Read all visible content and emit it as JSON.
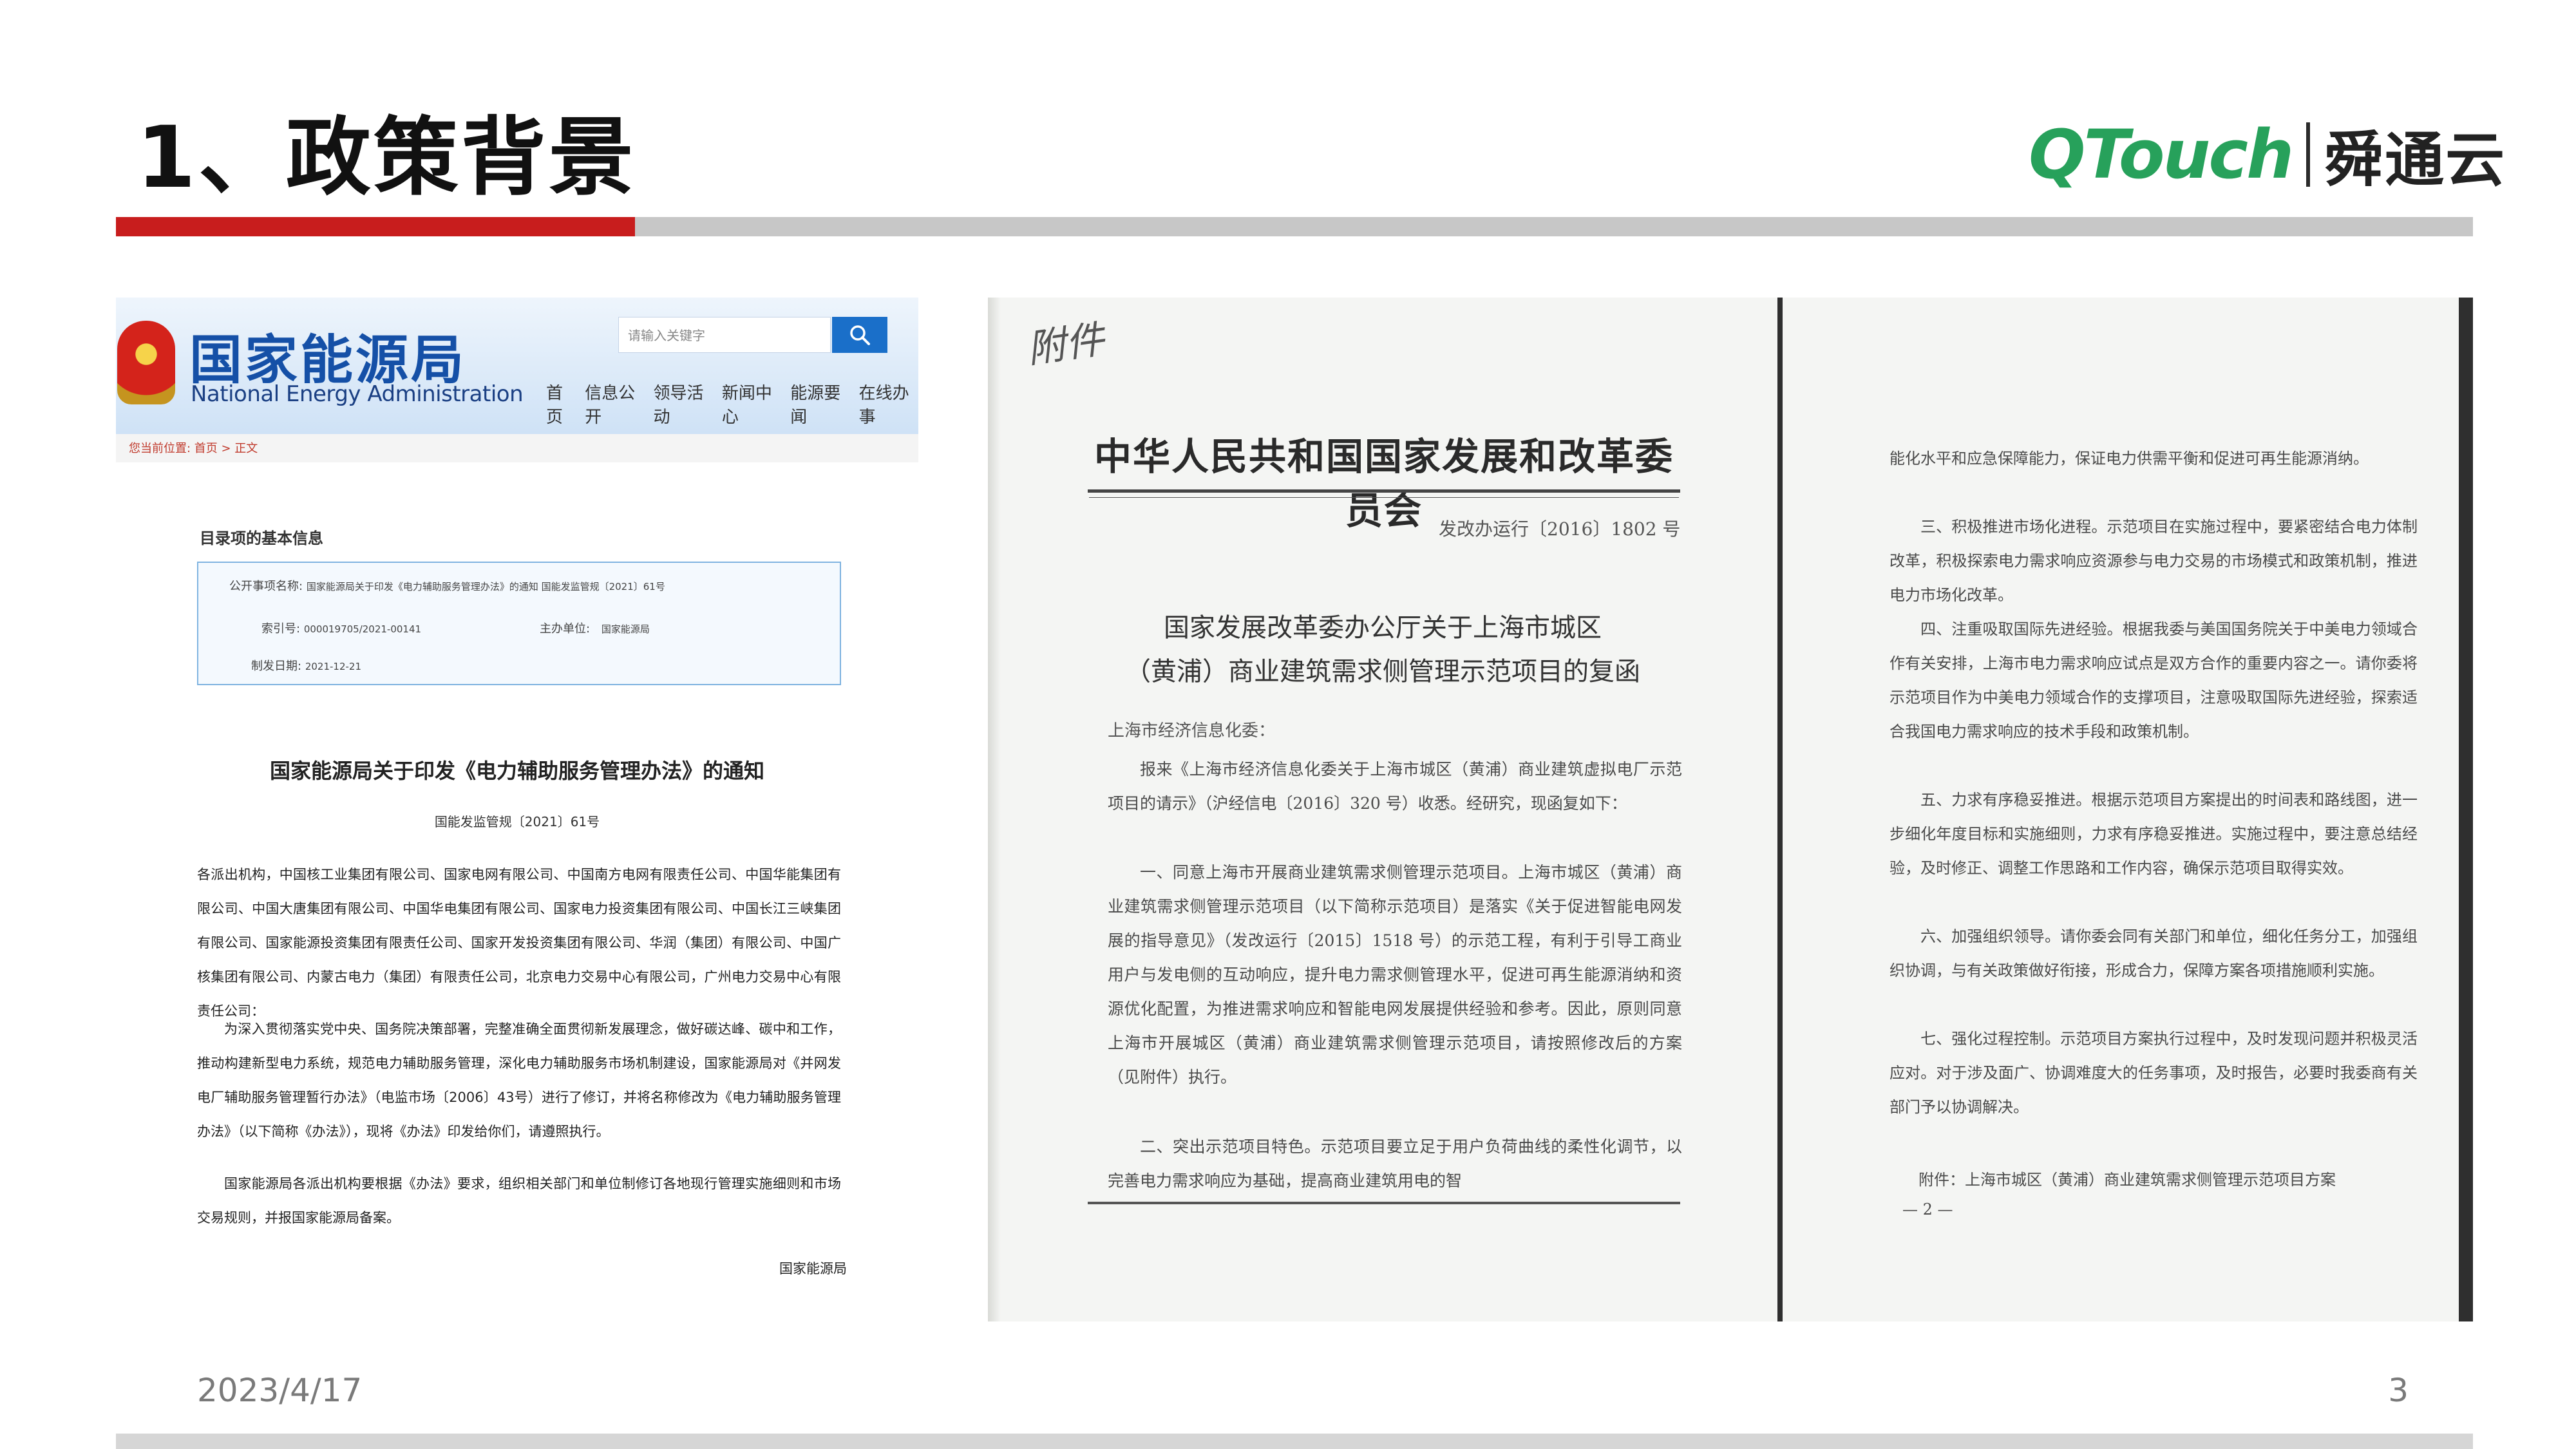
{
  "slide": {
    "title": "1、政策背景",
    "logo_brand": "QTouch",
    "logo_cn": "舜通云",
    "date": "2023/4/17",
    "page_number": "3",
    "accent_color": "#c81d1d"
  },
  "nea_page": {
    "site_name_cn": "国家能源局",
    "site_name_en": "National Energy Administration",
    "search_placeholder": "请输入关键字",
    "nav": [
      "首页",
      "信息公开",
      "领导活动",
      "新闻中心",
      "能源要闻",
      "在线办事"
    ],
    "breadcrumb": "您当前位置: 首页 > 正文",
    "info_heading": "目录项的基本信息",
    "info": {
      "name_label": "公开事项名称:",
      "name_value": "国家能源局关于印发《电力辅助服务管理办法》的通知 国能发监管规〔2021〕61号",
      "index_label": "索引号:",
      "index_value": "000019705/2021-00141",
      "dept_label": "主办单位:",
      "dept_value": "国家能源局",
      "date_label": "制发日期:",
      "date_value": "2021-12-21"
    },
    "notice_title": "国家能源局关于印发《电力辅助服务管理办法》的通知",
    "notice_no": "国能发监管规〔2021〕61号",
    "para1": "各派出机构，中国核工业集团有限公司、国家电网有限公司、中国南方电网有限责任公司、中国华能集团有限公司、中国大唐集团有限公司、中国华电集团有限公司、国家电力投资集团有限公司、中国长江三峡集团有限公司、国家能源投资集团有限责任公司、国家开发投资集团有限公司、华润（集团）有限公司、中国广核集团有限公司、内蒙古电力（集团）有限责任公司，北京电力交易中心有限公司，广州电力交易中心有限责任公司：",
    "para2": "为深入贯彻落实党中央、国务院决策部署，完整准确全面贯彻新发展理念，做好碳达峰、碳中和工作，推动构建新型电力系统，规范电力辅助服务管理，深化电力辅助服务市场机制建设，国家能源局对《并网发电厂辅助服务管理暂行办法》（电监市场〔2006〕43号）进行了修订，并将名称修改为《电力辅助服务管理办法》（以下简称《办法》），现将《办法》印发给你们，请遵照执行。",
    "para3": "国家能源局各派出机构要根据《办法》要求，组织相关部门和单位制修订各地现行管理实施细则和市场交易规则，并报国家能源局备案。",
    "signature": "国家能源局"
  },
  "ndrc_doc": {
    "annotation": "附件",
    "org": "中华人民共和国国家发展和改革委员会",
    "doc_no": "发改办运行〔2016〕1802 号",
    "title_line1": "国家发展改革委办公厅关于上海市城区",
    "title_line2": "（黄浦）商业建筑需求侧管理示范项目的复函",
    "salutation": "上海市经济信息化委：",
    "p1": "报来《上海市经济信息化委关于上海市城区（黄浦）商业建筑虚拟电厂示范项目的请示》（沪经信电〔2016〕320 号）收悉。经研究，现函复如下：",
    "p2": "一、同意上海市开展商业建筑需求侧管理示范项目。上海市城区（黄浦）商业建筑需求侧管理示范项目（以下简称示范项目）是落实《关于促进智能电网发展的指导意见》（发改运行〔2015〕1518 号）的示范工程，有利于引导工商业用户与发电侧的互动响应，提升电力需求侧管理水平，促进可再生能源消纳和资源优化配置，为推进需求响应和智能电网发展提供经验和参考。因此，原则同意上海市开展城区（黄浦）商业建筑需求侧管理示范项目，请按照修改后的方案（见附件）执行。",
    "p3": "二、突出示范项目特色。示范项目要立足于用户负荷曲线的柔性化调节，以完善电力需求响应为基础，提高商业建筑用电的智",
    "r0": "能化水平和应急保障能力，保证电力供需平衡和促进可再生能源消纳。",
    "r1": "三、积极推进市场化进程。示范项目在实施过程中，要紧密结合电力体制改革，积极探索电力需求响应资源参与电力交易的市场模式和政策机制，推进电力市场化改革。",
    "r2": "四、注重吸取国际先进经验。根据我委与美国国务院关于中美电力领域合作有关安排，上海市电力需求响应试点是双方合作的重要内容之一。请你委将示范项目作为中美电力领域合作的支撑项目，注意吸取国际先进经验，探索适合我国电力需求响应的技术手段和政策机制。",
    "r3": "五、力求有序稳妥推进。根据示范项目方案提出的时间表和路线图，进一步细化年度目标和实施细则，力求有序稳妥推进。实施过程中，要注意总结经验，及时修正、调整工作思路和工作内容，确保示范项目取得实效。",
    "r4": "六、加强组织领导。请你委会同有关部门和单位，细化任务分工，加强组织协调，与有关政策做好衔接，形成合力，保障方案各项措施顺利实施。",
    "r5": "七、强化过程控制。示范项目方案执行过程中，及时发现问题并积极灵活应对。对于涉及面广、协调难度大的任务事项，及时报告，必要时我委商有关部门予以协调解决。",
    "attachment": "附件：上海市城区（黄浦）商业建筑需求侧管理示范项目方案",
    "page_no": "— 2 —"
  }
}
